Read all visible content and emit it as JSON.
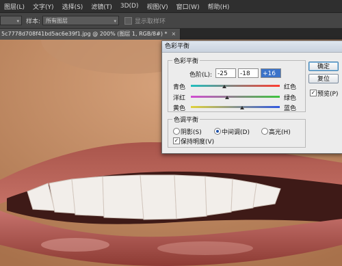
{
  "menu": [
    "图层(L)",
    "文字(Y)",
    "选择(S)",
    "滤镜(T)",
    "3D(D)",
    "视图(V)",
    "窗口(W)",
    "帮助(H)"
  ],
  "options": {
    "sample_label": "样本:",
    "sample_value": "所有图层",
    "show_ring_label": "显示取样环"
  },
  "document_tab": {
    "title": "5c7778d708f41bd5ac6e39f1.jpg @ 200% (图层 1, RGB/8#) *",
    "close": "×"
  },
  "dialog": {
    "title": "色彩平衡",
    "balance_group": "色彩平衡",
    "levels_label": "色阶(L):",
    "level_values": [
      "-25",
      "-18",
      "+16"
    ],
    "sliders": [
      {
        "left": "青色",
        "right": "红色",
        "value": -25
      },
      {
        "left": "洋红",
        "right": "绿色",
        "value": -18
      },
      {
        "left": "黄色",
        "right": "蓝色",
        "value": 16
      }
    ],
    "tone_group": "色调平衡",
    "tones": [
      "阴影(S)",
      "中间调(D)",
      "高光(H)"
    ],
    "tone_selected": 1,
    "preserve_luminosity": "保持明度(V)",
    "ok_button": "确定",
    "reset_button": "复位",
    "preview_label": "预览(P)"
  },
  "colors": {
    "cyan_red": [
      "#1fbfbf",
      "#ff3b2f"
    ],
    "magenta_green": [
      "#d24bd2",
      "#3dc43d"
    ],
    "yellow_blue": [
      "#e0d23a",
      "#3157e0"
    ]
  }
}
